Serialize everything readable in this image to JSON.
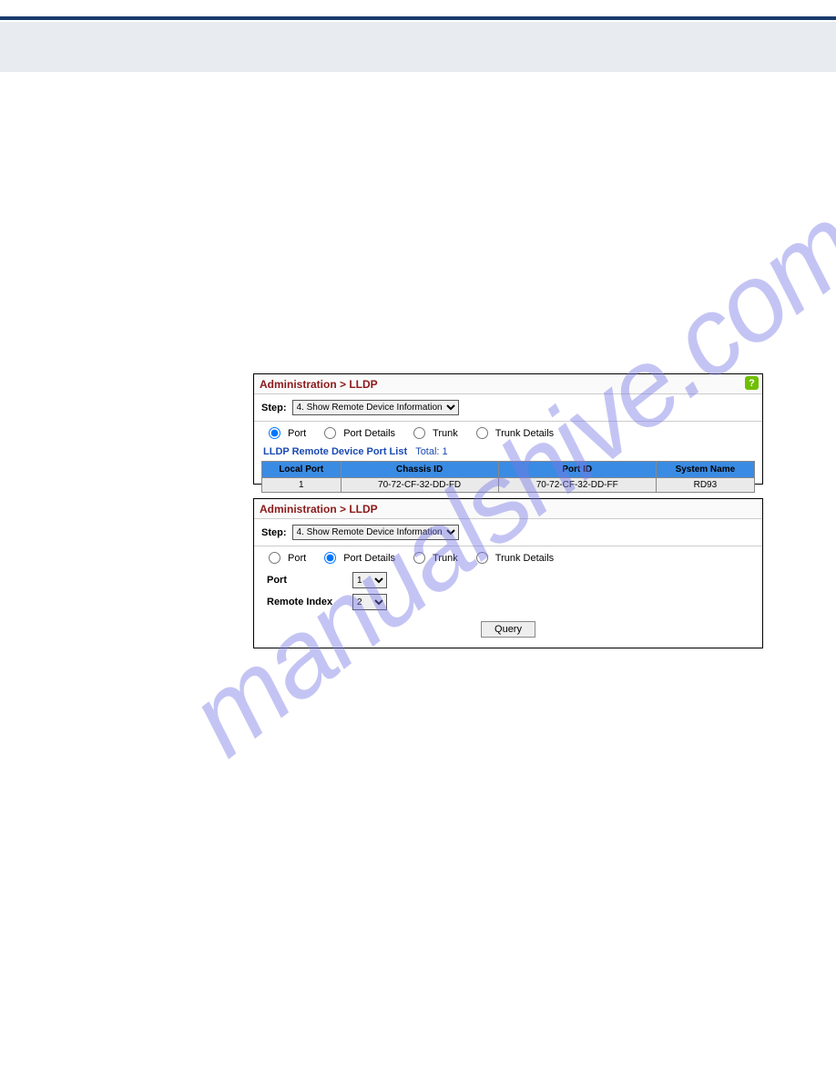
{
  "watermark": "manualshive.com",
  "panel1": {
    "breadcrumb": "Administration > LLDP",
    "step_label": "Step:",
    "step_value": "4. Show Remote Device Information",
    "radios": {
      "port": "Port",
      "port_details": "Port Details",
      "trunk": "Trunk",
      "trunk_details": "Trunk Details"
    },
    "list_title": "LLDP Remote Device Port List",
    "list_total_label": "Total:",
    "list_total_value": "1",
    "headers": {
      "local_port": "Local Port",
      "chassis_id": "Chassis ID",
      "port_id": "Port ID",
      "system_name": "System Name"
    },
    "row": {
      "local_port": "1",
      "chassis_id": "70-72-CF-32-DD-FD",
      "port_id": "70-72-CF-32-DD-FF",
      "system_name": "RD93"
    }
  },
  "panel2": {
    "breadcrumb": "Administration > LLDP",
    "step_label": "Step:",
    "step_value": "4. Show Remote Device Information",
    "radios": {
      "port": "Port",
      "port_details": "Port Details",
      "trunk": "Trunk",
      "trunk_details": "Trunk Details"
    },
    "port_label": "Port",
    "port_value": "1",
    "remote_index_label": "Remote Index",
    "remote_index_value": "2",
    "query_label": "Query"
  }
}
